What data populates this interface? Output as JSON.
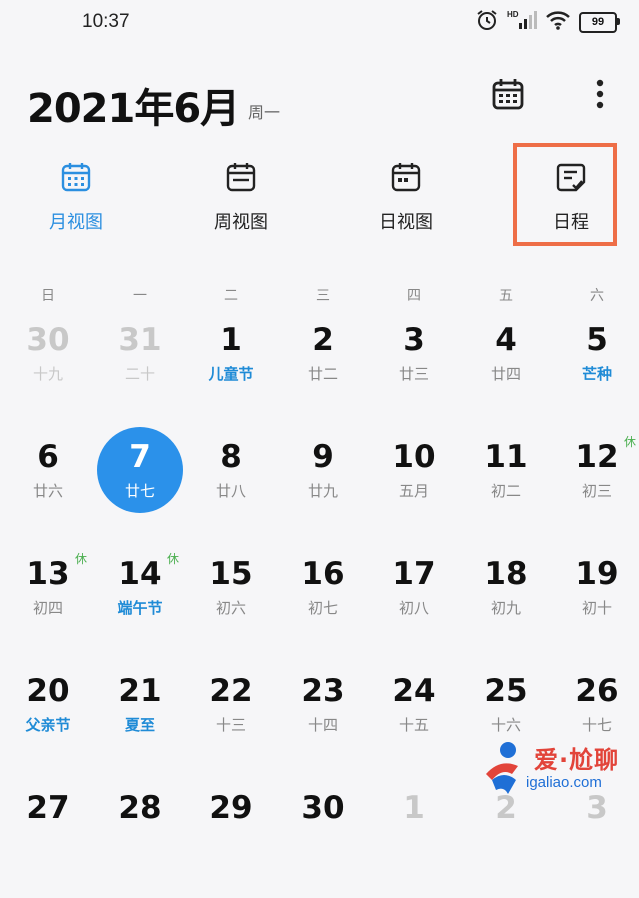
{
  "status": {
    "time": "10:37",
    "battery": "99",
    "hd_label": "HD"
  },
  "header": {
    "title": "2021年6月",
    "weekday": "周一"
  },
  "views": [
    {
      "label": "月视图",
      "icon": "month-view-icon",
      "active": true
    },
    {
      "label": "周视图",
      "icon": "week-view-icon",
      "active": false
    },
    {
      "label": "日视图",
      "icon": "day-view-icon",
      "active": false
    },
    {
      "label": "日程",
      "icon": "schedule-icon",
      "active": false
    }
  ],
  "weekdays": [
    "日",
    "一",
    "二",
    "三",
    "四",
    "五",
    "六"
  ],
  "days": [
    {
      "num": "30",
      "lunar": "十九",
      "other": true
    },
    {
      "num": "31",
      "lunar": "二十",
      "other": true
    },
    {
      "num": "1",
      "lunar": "儿童节",
      "festival": true
    },
    {
      "num": "2",
      "lunar": "廿二"
    },
    {
      "num": "3",
      "lunar": "廿三"
    },
    {
      "num": "4",
      "lunar": "廿四"
    },
    {
      "num": "5",
      "lunar": "芒种",
      "festival": true
    },
    {
      "num": "6",
      "lunar": "廿六"
    },
    {
      "num": "7",
      "lunar": "廿七",
      "today": true
    },
    {
      "num": "8",
      "lunar": "廿八"
    },
    {
      "num": "9",
      "lunar": "廿九"
    },
    {
      "num": "10",
      "lunar": "五月"
    },
    {
      "num": "11",
      "lunar": "初二"
    },
    {
      "num": "12",
      "lunar": "初三",
      "rest": "休"
    },
    {
      "num": "13",
      "lunar": "初四",
      "rest": "休"
    },
    {
      "num": "14",
      "lunar": "端午节",
      "festival": true,
      "rest": "休"
    },
    {
      "num": "15",
      "lunar": "初六"
    },
    {
      "num": "16",
      "lunar": "初七"
    },
    {
      "num": "17",
      "lunar": "初八"
    },
    {
      "num": "18",
      "lunar": "初九"
    },
    {
      "num": "19",
      "lunar": "初十"
    },
    {
      "num": "20",
      "lunar": "父亲节",
      "festival": true
    },
    {
      "num": "21",
      "lunar": "夏至",
      "festival": true
    },
    {
      "num": "22",
      "lunar": "十三"
    },
    {
      "num": "23",
      "lunar": "十四"
    },
    {
      "num": "24",
      "lunar": "十五"
    },
    {
      "num": "25",
      "lunar": "十六"
    },
    {
      "num": "26",
      "lunar": "十七"
    },
    {
      "num": "27",
      "lunar": ""
    },
    {
      "num": "28",
      "lunar": ""
    },
    {
      "num": "29",
      "lunar": ""
    },
    {
      "num": "30",
      "lunar": ""
    },
    {
      "num": "1",
      "lunar": "",
      "other": true
    },
    {
      "num": "2",
      "lunar": "",
      "other": true
    },
    {
      "num": "3",
      "lunar": "",
      "other": true
    }
  ],
  "watermark": {
    "text": "爱·尬聊",
    "url": "igaliao.com"
  },
  "colors": {
    "accent": "#2b91ea",
    "highlight": "#ee6e47",
    "rest": "#4caf50"
  }
}
